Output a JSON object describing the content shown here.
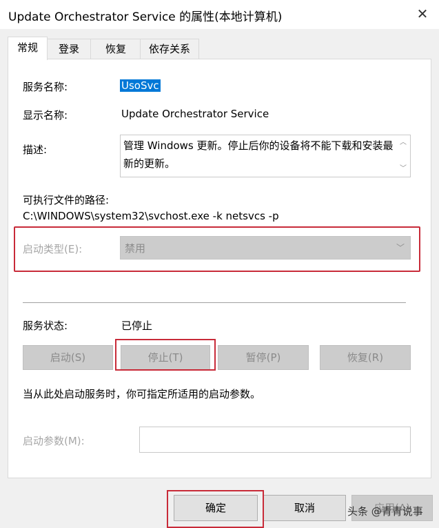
{
  "window": {
    "title": "Update Orchestrator Service 的属性(本地计算机)",
    "close_glyph": "✕"
  },
  "tabs": [
    {
      "label": "常规",
      "active": true
    },
    {
      "label": "登录",
      "active": false
    },
    {
      "label": "恢复",
      "active": false
    },
    {
      "label": "依存关系",
      "active": false
    }
  ],
  "general": {
    "service_name_label": "服务名称:",
    "service_name_value": "UsoSvc",
    "display_name_label": "显示名称:",
    "display_name_value": "Update Orchestrator Service",
    "description_label": "描述:",
    "description_value": "管理 Windows 更新。停止后你的设备将不能下载和安装最新的更新。",
    "path_label": "可执行文件的路径:",
    "path_value": "C:\\WINDOWS\\system32\\svchost.exe -k netsvcs -p",
    "startup_type_label": "启动类型(E):",
    "startup_type_value": "禁用",
    "service_status_label": "服务状态:",
    "service_status_value": "已停止",
    "start_button": "启动(S)",
    "stop_button": "停止(T)",
    "pause_button": "暂停(P)",
    "resume_button": "恢复(R)",
    "hint_text": "当从此处启动服务时，你可指定所适用的启动参数。",
    "start_params_label": "启动参数(M):",
    "start_params_value": ""
  },
  "footer": {
    "ok_button": "确定",
    "cancel_button": "取消",
    "apply_button": "应用(A)"
  },
  "watermark": "头条 @青青说事",
  "colors": {
    "highlight": "#0078d7",
    "annotation_red": "#c82a38"
  }
}
